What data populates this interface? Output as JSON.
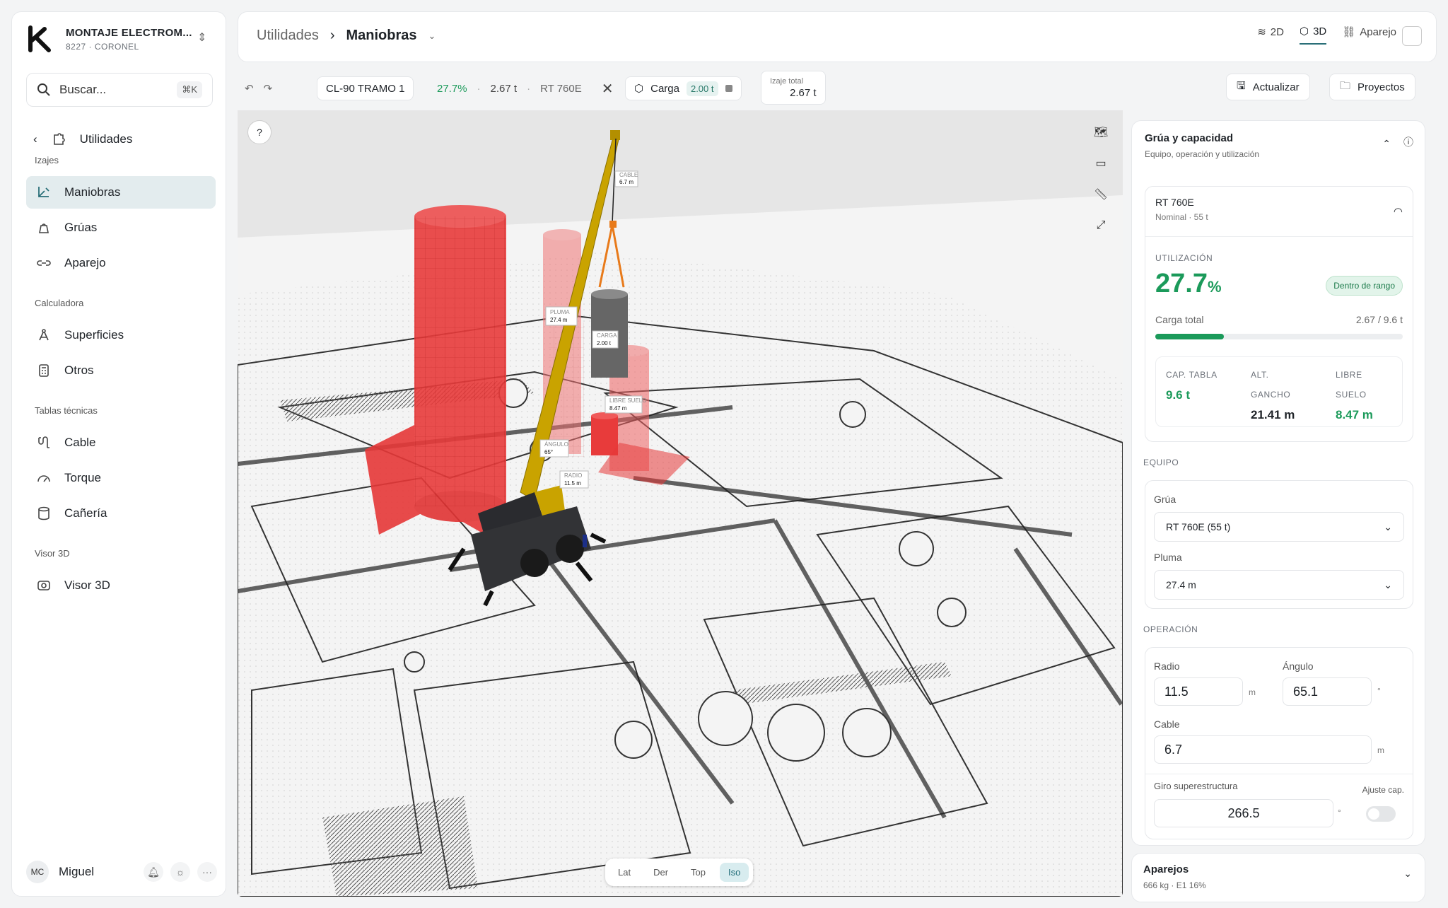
{
  "brand": {
    "title": "MONTAJE ELECTROM...",
    "subtitle": "8227 · CORONEL"
  },
  "search": {
    "placeholder": "Buscar...",
    "shortcut": "⌘K"
  },
  "sidebar": {
    "back_label": "Utilidades",
    "sections": [
      {
        "title": "Izajes",
        "items": [
          {
            "label": "Maniobras",
            "icon": "crane-route-icon",
            "active": true
          },
          {
            "label": "Grúas",
            "icon": "weight-icon"
          },
          {
            "label": "Aparejo",
            "icon": "link-icon"
          }
        ]
      },
      {
        "title": "Calculadora",
        "items": [
          {
            "label": "Superficies",
            "icon": "compass-icon"
          },
          {
            "label": "Otros",
            "icon": "calculator-icon"
          }
        ]
      },
      {
        "title": "Tablas técnicas",
        "items": [
          {
            "label": "Cable",
            "icon": "cable-icon"
          },
          {
            "label": "Torque",
            "icon": "gauge-icon"
          },
          {
            "label": "Cañería",
            "icon": "pipe-icon"
          }
        ]
      },
      {
        "title": "Visor 3D",
        "items": [
          {
            "label": "Visor 3D",
            "icon": "view-3d-icon"
          }
        ]
      }
    ],
    "user": {
      "initials": "MC",
      "name": "Miguel"
    }
  },
  "header": {
    "crumb_parent": "Utilidades",
    "crumb_current": "Maniobras",
    "views": [
      "2D",
      "3D",
      "Aparejo"
    ],
    "active_view": "3D"
  },
  "toolbar": {
    "maneuver": "CL-90 TRAMO 1",
    "utilization": "27.7%",
    "weight": "2.67 t",
    "crane": "RT 760E",
    "load_label": "Carga",
    "load_value": "2.00 t",
    "total_label": "Izaje total",
    "total_value": "2.67 t",
    "update_label": "Actualizar",
    "projects_label": "Proyectos"
  },
  "viewport": {
    "view_buttons": [
      "Lat",
      "Der",
      "Top",
      "Iso"
    ],
    "active_view_button": "Iso",
    "labels": [
      {
        "title": "CABLE",
        "value": "6.7 m"
      },
      {
        "title": "PLUMA",
        "value": "27.4 m"
      },
      {
        "title": "CARGA",
        "value": "2.00 t"
      },
      {
        "title": "LIBRE SUELO",
        "value": "8.47 m"
      },
      {
        "title": "ÁNGULO",
        "value": "65°"
      },
      {
        "title": "RADIO",
        "value": "11.5 m"
      }
    ]
  },
  "panel": {
    "title": "Grúa y capacidad",
    "subtitle": "Equipo, operación y utilización",
    "crane_name": "RT 760E",
    "crane_nominal": "Nominal · 55 t",
    "util_label": "UTILIZACIÓN",
    "util_value": "27.7",
    "util_unit": "%",
    "util_fraction": 0.277,
    "range_badge": "Dentro de rango",
    "load_label": "Carga total",
    "load_value": "2.67 / 9.6 t",
    "stats": [
      {
        "label1": "CAP. TABLA",
        "label2": "",
        "value": "9.6 t",
        "color": "green"
      },
      {
        "label1": "ALT.",
        "label2": "GANCHO",
        "value": "21.41 m",
        "color": "dark"
      },
      {
        "label1": "LIBRE",
        "label2": "SUELO",
        "value": "8.47 m",
        "color": "green"
      }
    ],
    "equipo_title": "EQUIPO",
    "grua_label": "Grúa",
    "grua_value": "RT 760E (55 t)",
    "pluma_label": "Pluma",
    "pluma_value": "27.4 m",
    "operacion_title": "OPERACIÓN",
    "radio_label": "Radio",
    "radio_value": "11.5",
    "radio_unit": "m",
    "angulo_label": "Ángulo",
    "angulo_value": "65.1",
    "angulo_unit": "°",
    "cable_label": "Cable",
    "cable_value": "6.7",
    "cable_unit": "m",
    "giro_label": "Giro superestructura",
    "giro_value": "266.5",
    "giro_unit": "°",
    "ajuste_label": "Ajuste cap.",
    "aparejos_title": "Aparejos",
    "aparejos_sub": "666 kg · E1 16%"
  },
  "colors": {
    "accent": "#1b9a5a",
    "teal": "#2a6f78",
    "red_zone": "#e63838",
    "boom": "#c9a300"
  }
}
